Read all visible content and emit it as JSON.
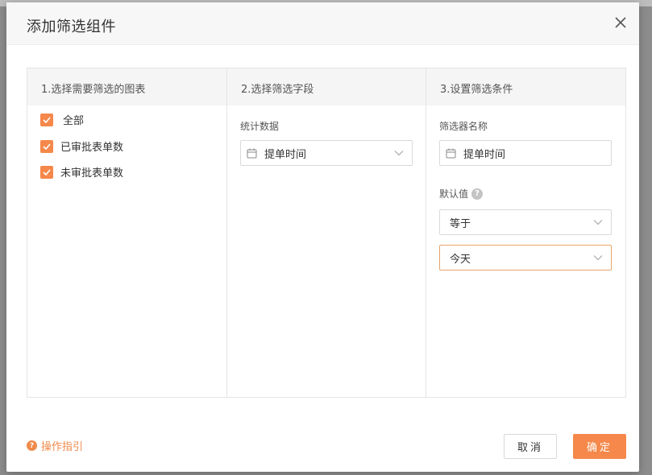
{
  "dialog": {
    "title": "添加筛选组件"
  },
  "panels": {
    "chart": {
      "header": "1.选择需要筛选的图表",
      "items": [
        {
          "label": "全部",
          "checked": true
        },
        {
          "label": "已审批表单数",
          "checked": true
        },
        {
          "label": "未审批表单数",
          "checked": true
        }
      ]
    },
    "field": {
      "header": "2.选择筛选字段",
      "group_label": "统计数据",
      "selected": "提单时间"
    },
    "condition": {
      "header": "3.设置筛选条件",
      "name_label": "筛选器名称",
      "name_value": "提单时间",
      "default_label": "默认值",
      "help_glyph": "?",
      "operator": "等于",
      "value": "今天"
    }
  },
  "footer": {
    "guide_link": "操作指引",
    "guide_glyph": "?",
    "cancel": "取消",
    "ok": "确定"
  },
  "colors": {
    "accent": "#f5884a",
    "link": "#f08a4b",
    "focus_border": "#e6a56c"
  },
  "icons": [
    "close-icon",
    "checkmark-icon",
    "calendar-icon",
    "chevron-down-icon",
    "help-icon"
  ]
}
